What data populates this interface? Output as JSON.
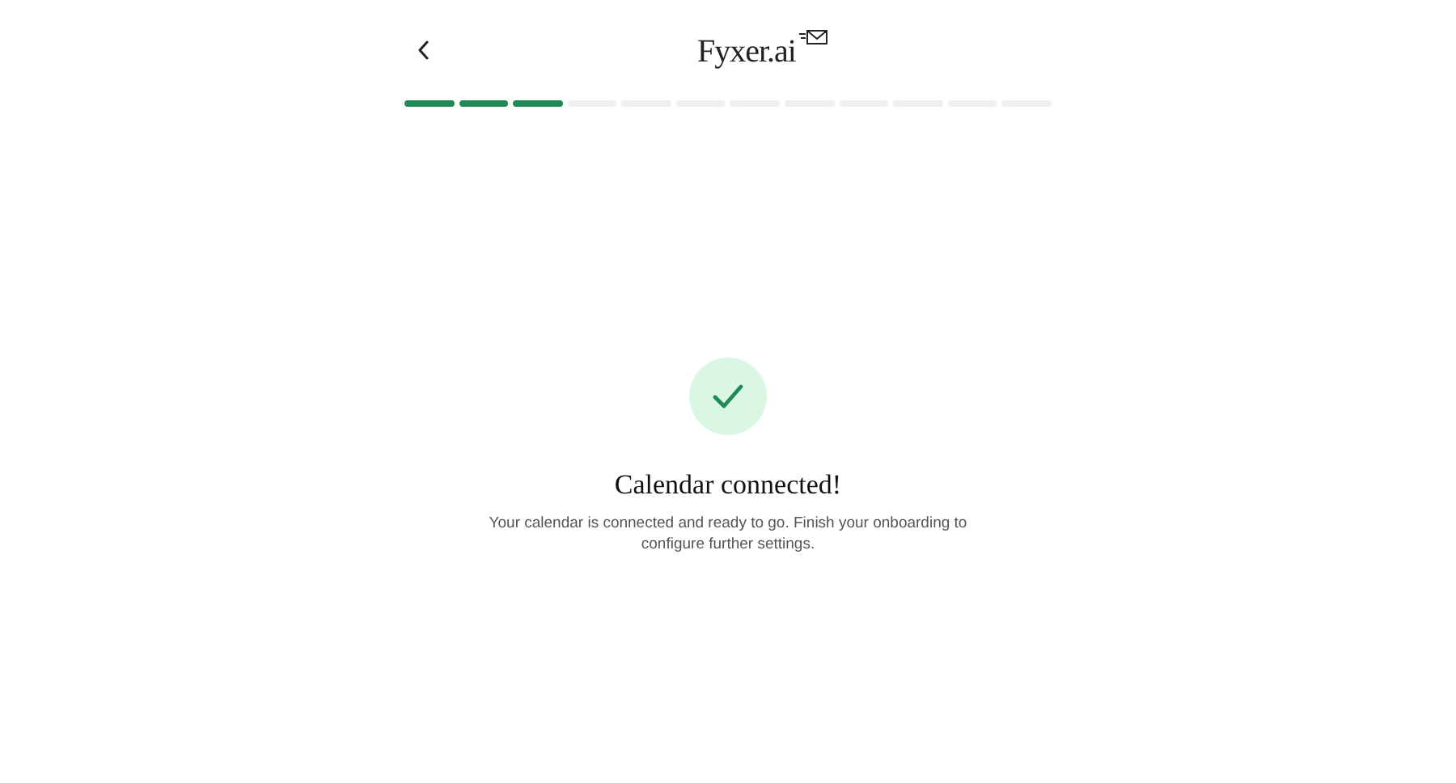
{
  "header": {
    "logo": "Fyxer.ai"
  },
  "progress": [
    {
      "done": true
    },
    {
      "done": true
    },
    {
      "done": true
    },
    {
      "done": false
    },
    {
      "done": false
    },
    {
      "done": false
    },
    {
      "done": false
    },
    {
      "done": false
    },
    {
      "done": false
    },
    {
      "done": false
    },
    {
      "done": false
    },
    {
      "done": false
    }
  ],
  "message": {
    "title": "Calendar connected!",
    "body": "Your calendar is connected and ready to go. Finish your onboarding to configure further settings."
  }
}
